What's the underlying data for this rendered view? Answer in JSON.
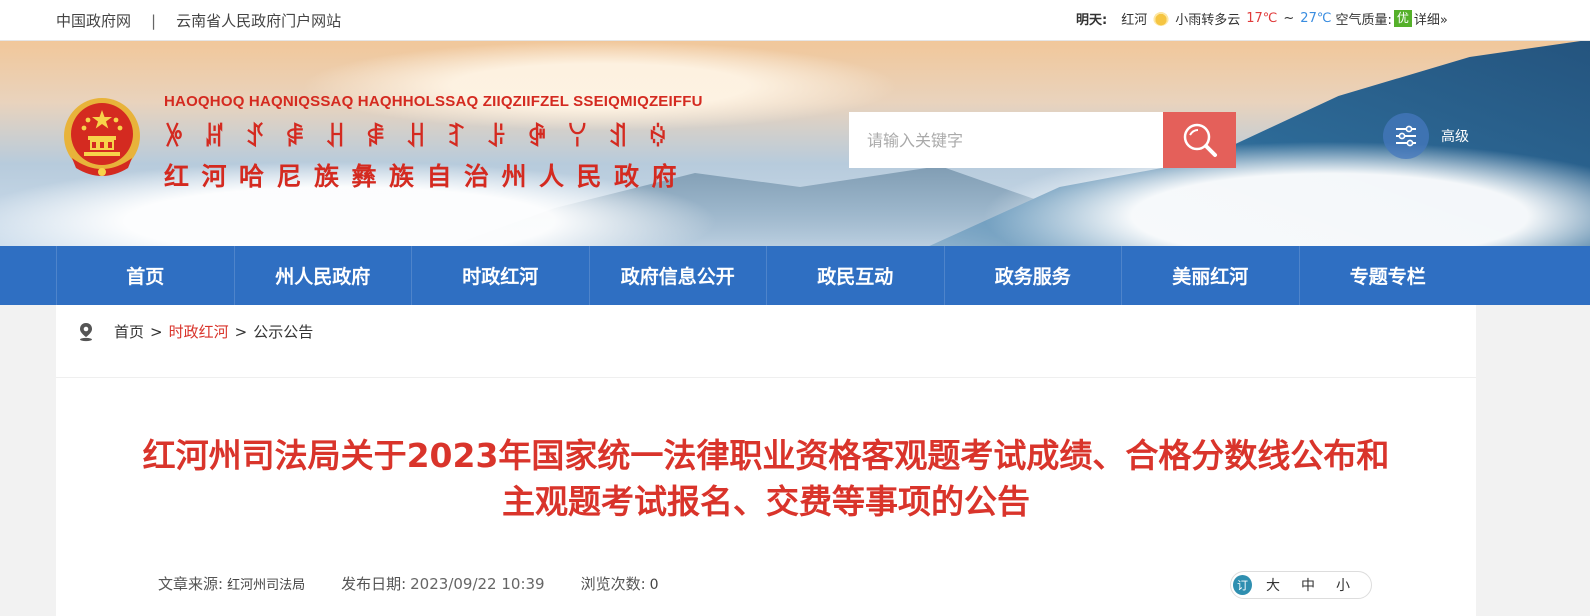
{
  "topbar": {
    "link_gov": "中国政府网",
    "separator": "|",
    "link_province": "云南省人民政府门户网站"
  },
  "weather": {
    "day": "明天:",
    "city": "红河",
    "icon": "partly-cloudy-sun-icon",
    "desc": "小雨转多云",
    "temp_high": "17℃",
    "tilde": "~",
    "temp_low": "27℃",
    "air_label": "空气质量:",
    "air_value": "优",
    "detail": "详细»"
  },
  "header": {
    "title_latin": "HAOQHOQ HAQNIQSSAQ HAQHHOLSSAQ ZIIQZIIFZEL SSEIQMIQZEIFFU",
    "title_yi": "ꉼꏦꀋꍂꃅꍂꃅꆈꌠꋤꌩꀊꍈ",
    "title_zh": "红河哈尼族彝族自治州人民政府",
    "search_placeholder": "请输入关键字",
    "advanced_label": "高级"
  },
  "nav": {
    "items": [
      "首页",
      "州人民政府",
      "时政红河",
      "政府信息公开",
      "政民互动",
      "政务服务",
      "美丽红河",
      "专题专栏"
    ]
  },
  "breadcrumb": {
    "home": "首页",
    "gt1": ">",
    "section": "时政红河",
    "gt2": ">",
    "current": "公示公告"
  },
  "article": {
    "title_line1": "红河州司法局关于2023年国家统一法律职业资格客观题考试成绩、合格分数线公布和",
    "title_line2": "主观题考试报名、交费等事项的公告",
    "source_label": "文章来源:",
    "source_value": "红河州司法局",
    "date_label": "发布日期:",
    "date_value": "2023/09/22 10:39",
    "views_label": "浏览次数:",
    "views_value": "0"
  },
  "font_size": {
    "icon_glyph": "订",
    "large": "大",
    "medium": "中",
    "small": "小"
  },
  "colors": {
    "brand_red": "#d42a20",
    "nav_blue": "#2f6fc2",
    "search_button": "#e4605a"
  }
}
